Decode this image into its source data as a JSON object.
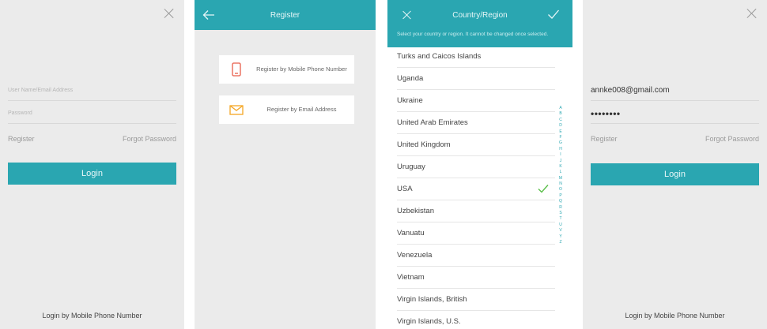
{
  "login_panel_1": {
    "username_placeholder": "User Name/Email Address",
    "password_placeholder": "Password",
    "register_label": "Register",
    "forgot_label": "Forgot Password",
    "login_label": "Login",
    "mobile_login_label": "Login by Mobile Phone Number"
  },
  "register_panel": {
    "title": "Register",
    "options": [
      {
        "label": "Register by Mobile Phone Number",
        "icon": "phone-icon",
        "color": "#e85d4a"
      },
      {
        "label": "Register by Email Address",
        "icon": "envelope-icon",
        "color": "#f5a623"
      }
    ]
  },
  "country_panel": {
    "title": "Country/Region",
    "hint": "Select your country or region. It cannot be changed once selected.",
    "countries": [
      {
        "name": "Turks and Caicos Islands",
        "selected": false
      },
      {
        "name": "Uganda",
        "selected": false
      },
      {
        "name": "Ukraine",
        "selected": false
      },
      {
        "name": "United Arab Emirates",
        "selected": false
      },
      {
        "name": "United Kingdom",
        "selected": false
      },
      {
        "name": "Uruguay",
        "selected": false
      },
      {
        "name": "USA",
        "selected": true
      },
      {
        "name": "Uzbekistan",
        "selected": false
      },
      {
        "name": "Vanuatu",
        "selected": false
      },
      {
        "name": "Venezuela",
        "selected": false
      },
      {
        "name": "Vietnam",
        "selected": false
      },
      {
        "name": "Virgin Islands, British",
        "selected": false
      },
      {
        "name": "Virgin Islands, U.S.",
        "selected": false
      }
    ],
    "index_letters": [
      "A",
      "B",
      "C",
      "D",
      "E",
      "F",
      "G",
      "H",
      "I",
      "J",
      "K",
      "L",
      "M",
      "N",
      "O",
      "P",
      "Q",
      "R",
      "S",
      "T",
      "U",
      "V",
      "Y",
      "Z"
    ]
  },
  "login_panel_2": {
    "username_value": "annke008@gmail.com",
    "password_value": "••••••••",
    "register_label": "Register",
    "forgot_label": "Forgot Password",
    "login_label": "Login",
    "mobile_login_label": "Login by Mobile Phone Number"
  },
  "colors": {
    "accent": "#2aa6b1",
    "background": "#ebebeb",
    "check": "#5bbf4a"
  }
}
